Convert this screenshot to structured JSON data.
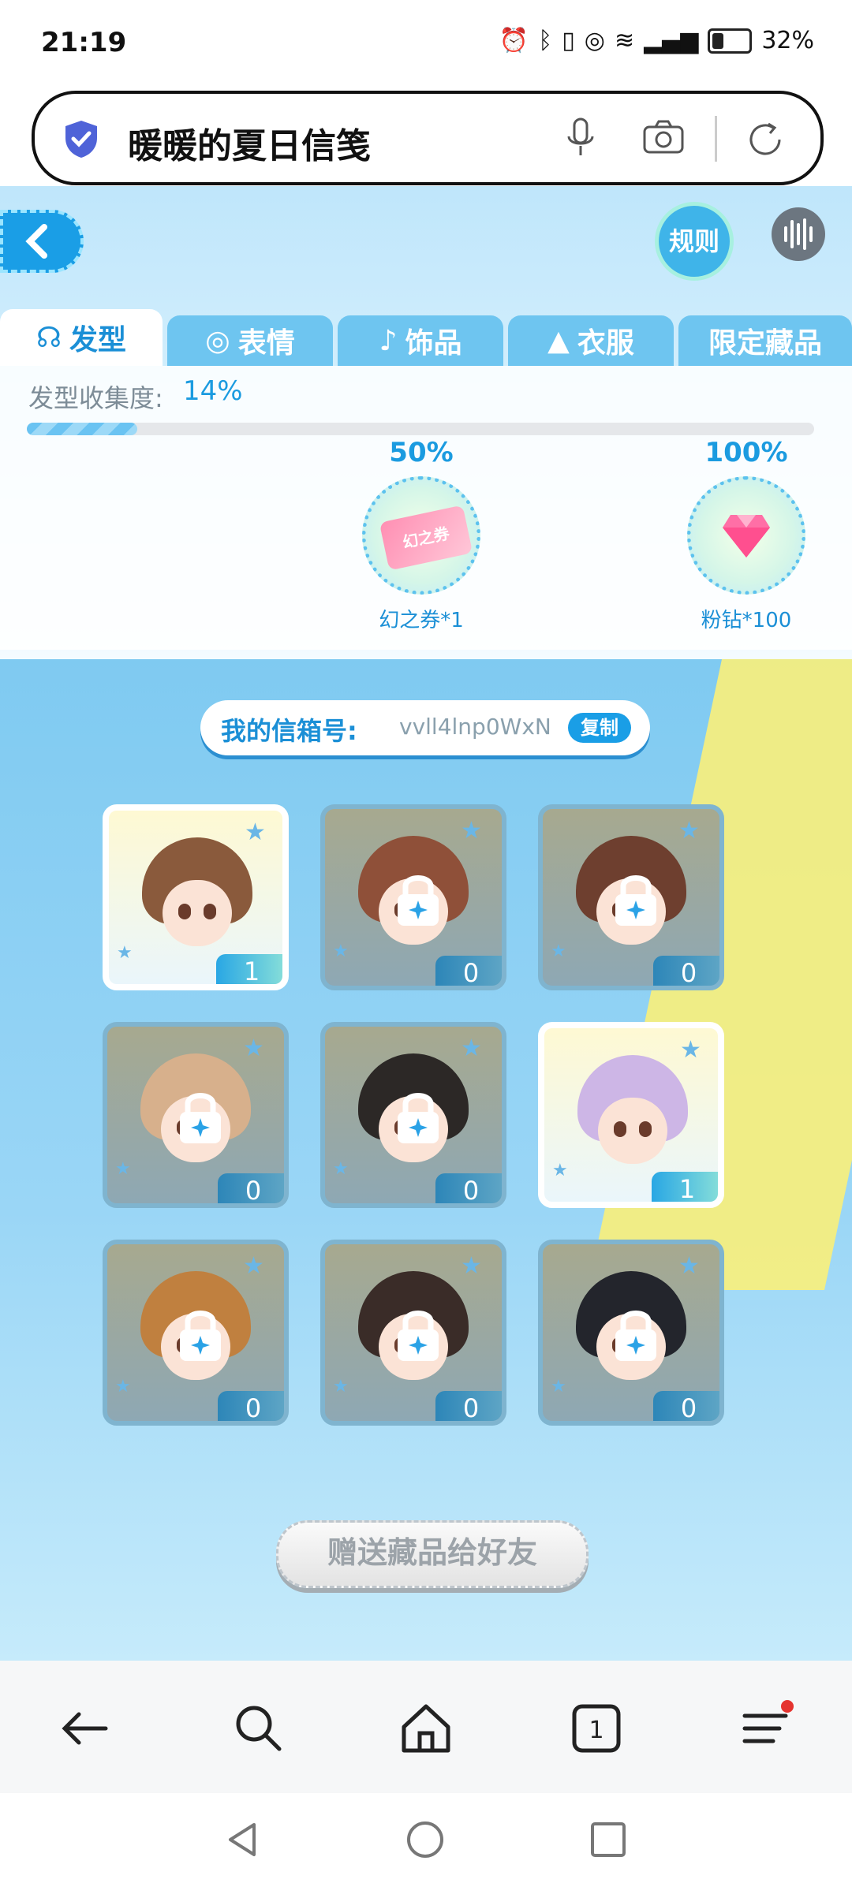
{
  "status": {
    "time": "21:19",
    "battery": "32%",
    "battery_level": 0.32
  },
  "address": {
    "title": "暖暖的夏日信笺"
  },
  "game": {
    "rules_label": "规则",
    "tabs": [
      {
        "label": "发型",
        "active": true
      },
      {
        "label": "表情",
        "active": false
      },
      {
        "label": "饰品",
        "active": false
      },
      {
        "label": "衣服",
        "active": false
      },
      {
        "label": "限定藏品",
        "active": false
      }
    ],
    "progress": {
      "label": "发型收集度:",
      "value": "14%",
      "fraction": 0.14
    },
    "milestones": [
      {
        "pct": "50%",
        "reward": "幻之券*1",
        "ticket_text": "幻之券"
      },
      {
        "pct": "100%",
        "reward": "粉钻*100"
      }
    ],
    "mailbox": {
      "label": "我的信箱号:",
      "value": "vvll4lnp0WxN",
      "copy": "复制"
    },
    "items": [
      {
        "count": "1",
        "locked": false,
        "hair": "#8a5a3c"
      },
      {
        "count": "0",
        "locked": true,
        "hair": "#8f5039"
      },
      {
        "count": "0",
        "locked": true,
        "hair": "#6e3f2f"
      },
      {
        "count": "0",
        "locked": true,
        "hair": "#d7b08c"
      },
      {
        "count": "0",
        "locked": true,
        "hair": "#2c2826"
      },
      {
        "count": "1",
        "locked": false,
        "hair": "#cdb6e6"
      },
      {
        "count": "0",
        "locked": true,
        "hair": "#c0803f"
      },
      {
        "count": "0",
        "locked": true,
        "hair": "#3a2c28"
      },
      {
        "count": "0",
        "locked": true,
        "hair": "#23252c"
      }
    ],
    "gift_button": "赠送藏品给好友"
  },
  "colors": {
    "accent": "#1a9ee6",
    "tab_bg": "#6ec5f0",
    "gift_text": "#9ca3a9"
  }
}
